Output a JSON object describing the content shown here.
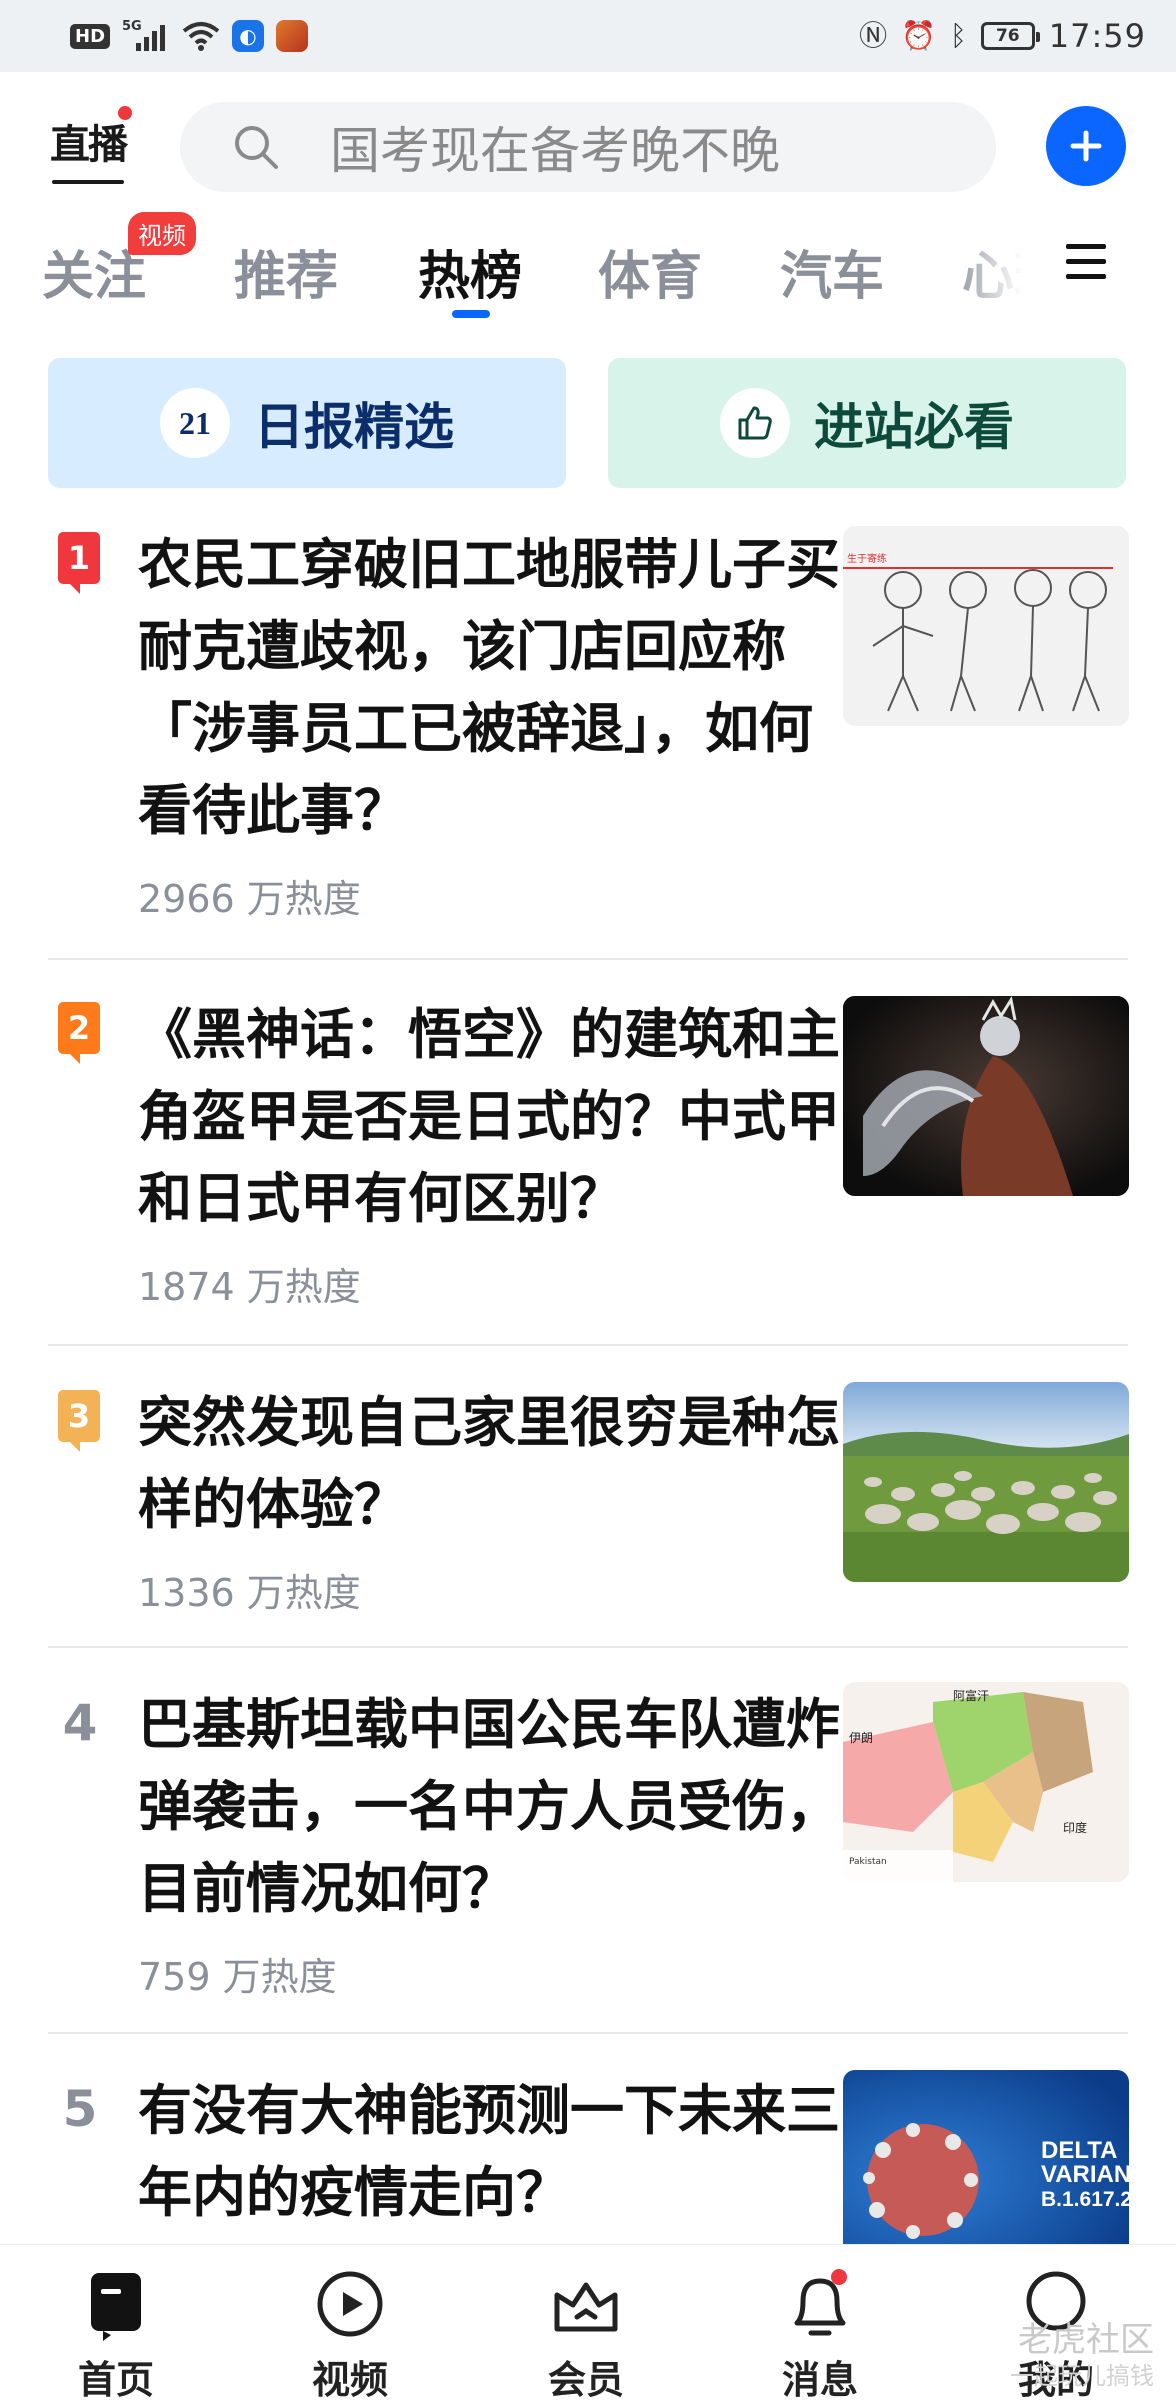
{
  "status_bar": {
    "hd": "HD",
    "net": "5G",
    "battery": "76",
    "time": "17:59"
  },
  "header": {
    "logo": "直播",
    "search_placeholder": "国考现在备考晚不晚"
  },
  "tabs": [
    {
      "label": "关注"
    },
    {
      "label": "推荐"
    },
    {
      "label": "热榜"
    },
    {
      "label": "体育"
    },
    {
      "label": "汽车"
    },
    {
      "label": "心理"
    }
  ],
  "active_tab": "热榜",
  "tab_badge": "视频",
  "cards": {
    "daily_icon": "21",
    "daily_label": "日报精选",
    "must_label": "进站必看"
  },
  "hot_list": [
    {
      "rank": "1",
      "title": "农民工穿破旧工地服带儿子买耐克遭歧视，该门店回应称「涉事员工已被辞退」，如何看待此事？",
      "heat": "2966 万热度",
      "thumb_text": "生于寄练"
    },
    {
      "rank": "2",
      "title": "《黑神话：悟空》的建筑和主角盔甲是否是日式的？中式甲和日式甲有何区别？",
      "heat": "1874 万热度"
    },
    {
      "rank": "3",
      "title": "突然发现自己家里很穷是种怎样的体验？",
      "heat": "1336 万热度"
    },
    {
      "rank": "4",
      "title": "巴基斯坦载中国公民车队遭炸弹袭击，一名中方人员受伤，目前情况如何？",
      "heat": "759 万热度",
      "map_labels": [
        "阿富汗",
        "伊朗",
        "印度",
        "Pakistan"
      ]
    },
    {
      "rank": "5",
      "title": "有没有大神能预测一下未来三年内的疫情走向？",
      "thumb_text_1": "DELTA",
      "thumb_text_2": "VARIANT",
      "thumb_text_3": "B.1.617.2"
    }
  ],
  "rank_colors": {
    "1": "#f0373d",
    "2": "#ff7a1a",
    "3": "#f2b255"
  },
  "bottom_nav": [
    {
      "label": "首页"
    },
    {
      "label": "视频"
    },
    {
      "label": "会员"
    },
    {
      "label": "消息"
    },
    {
      "label": "我的"
    }
  ],
  "watermark": "老虎社区",
  "watermark_sub": "一起玩儿搞钱",
  "accent_color": "#0a66ff"
}
